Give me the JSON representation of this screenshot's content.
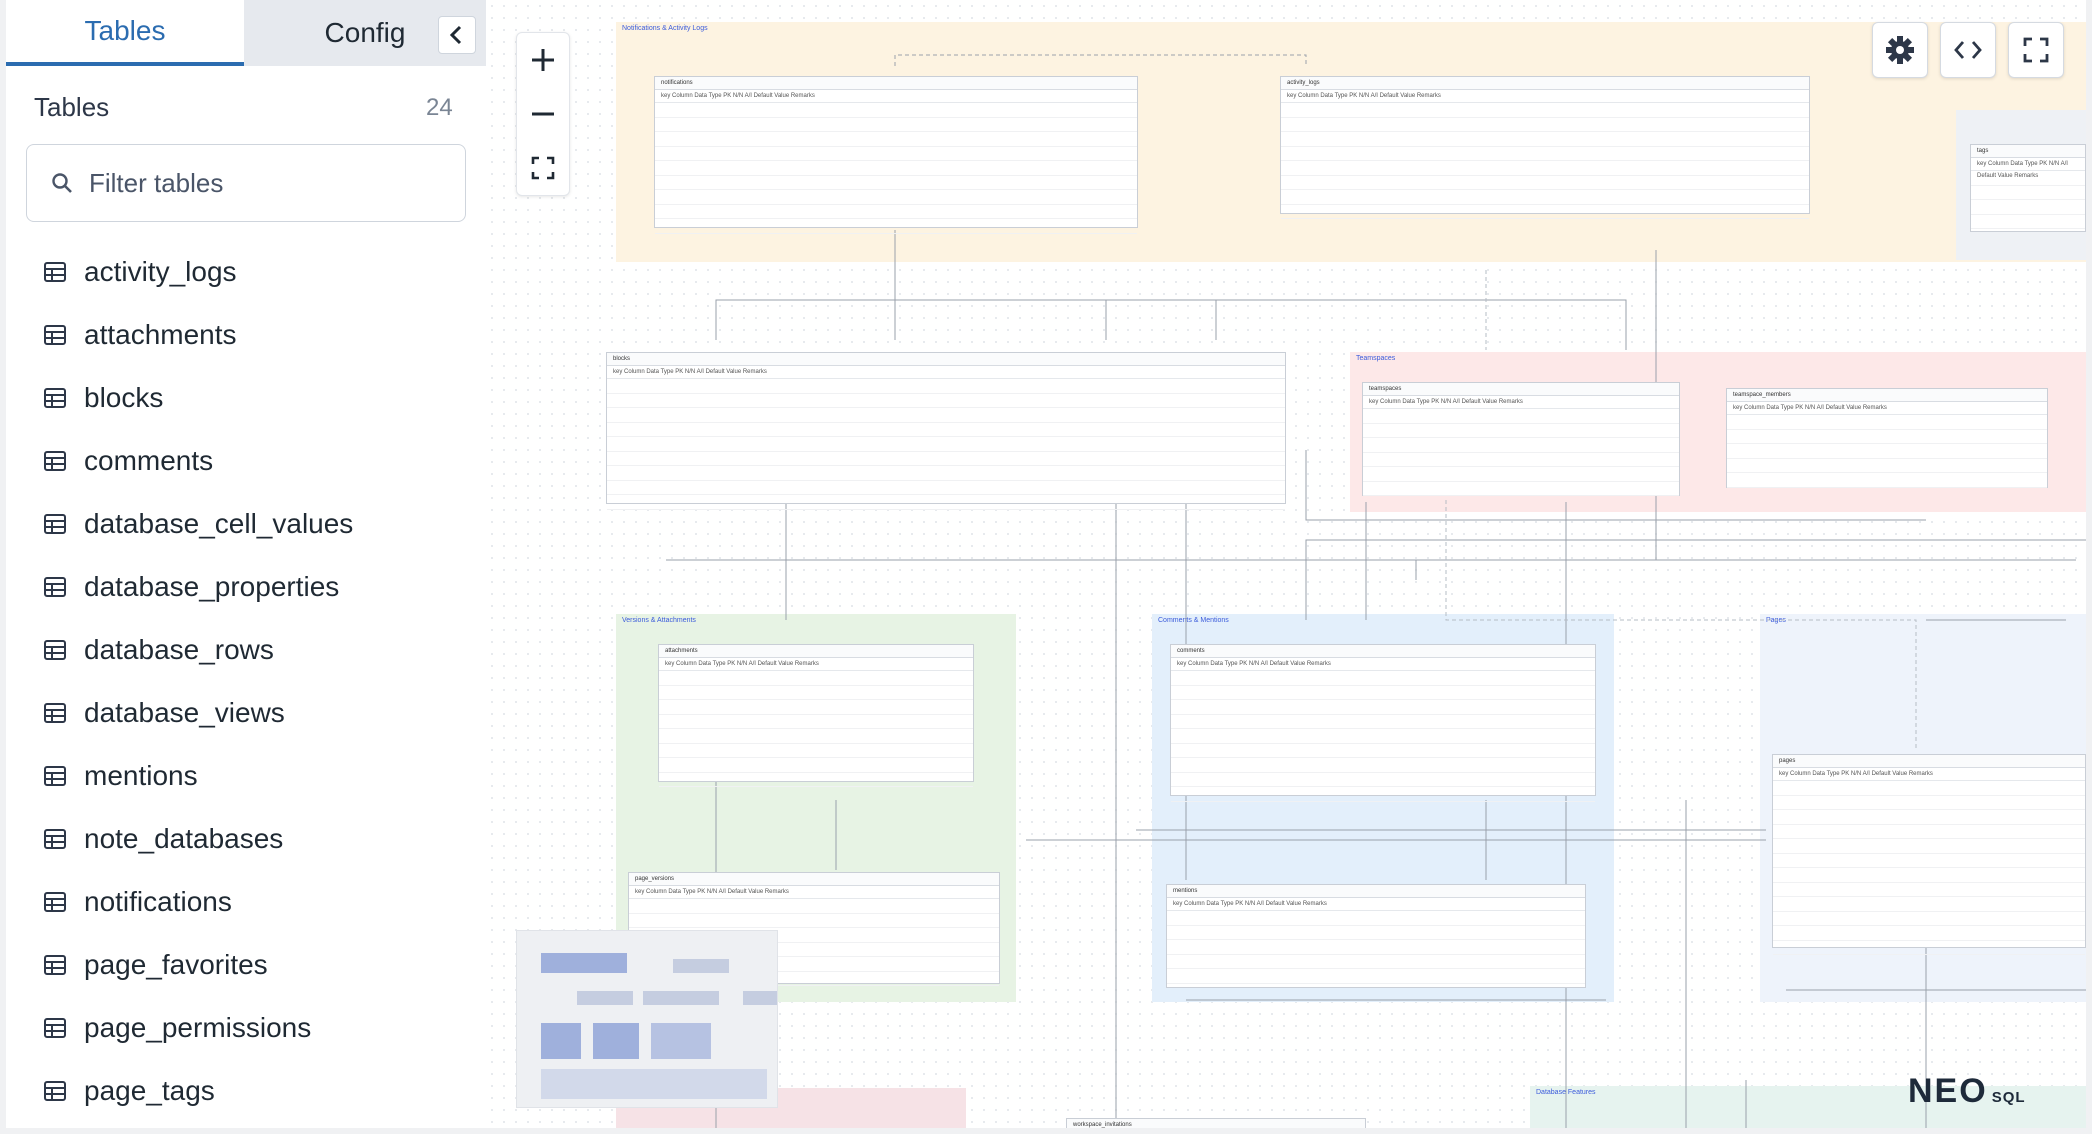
{
  "sidebar": {
    "tabs": [
      {
        "label": "Tables"
      },
      {
        "label": "Config"
      }
    ],
    "section_title": "Tables",
    "table_count": "24",
    "filter_placeholder": "Filter tables",
    "tables": [
      {
        "label": "activity_logs"
      },
      {
        "label": "attachments"
      },
      {
        "label": "blocks"
      },
      {
        "label": "comments"
      },
      {
        "label": "database_cell_values"
      },
      {
        "label": "database_properties"
      },
      {
        "label": "database_rows"
      },
      {
        "label": "database_views"
      },
      {
        "label": "mentions"
      },
      {
        "label": "note_databases"
      },
      {
        "label": "notifications"
      },
      {
        "label": "page_favorites"
      },
      {
        "label": "page_permissions"
      },
      {
        "label": "page_tags"
      }
    ]
  },
  "toolbar": {
    "icons": [
      "plus-icon",
      "minus-icon",
      "fit-screen-icon",
      "gear-icon",
      "code-icon",
      "fullscreen-icon"
    ]
  },
  "canvas": {
    "groups": [
      {
        "label": "Notifications & Activity Logs",
        "color": "#fdf3e1"
      },
      {
        "label": "Teamspaces",
        "color": "#fde8e8"
      },
      {
        "label": "Versions & Attachments",
        "color": "#e7f3e4"
      },
      {
        "label": "Comments & Mentions",
        "color": "#e3effb"
      },
      {
        "label": "Pages",
        "color": "#eef3fb"
      },
      {
        "label": "Database Features",
        "color": "#e6f3ef"
      }
    ],
    "tables": [
      {
        "name": "notifications"
      },
      {
        "name": "activity_logs"
      },
      {
        "name": "tags"
      },
      {
        "name": "blocks"
      },
      {
        "name": "teamspaces"
      },
      {
        "name": "teamspace_members"
      },
      {
        "name": "attachments"
      },
      {
        "name": "comments"
      },
      {
        "name": "pages"
      },
      {
        "name": "page_versions"
      },
      {
        "name": "mentions"
      },
      {
        "name": "workspace_invitations"
      }
    ],
    "column_headers": [
      "key",
      "Column",
      "Data Type",
      "PK",
      "N/N",
      "A/I",
      "Default Value",
      "Remarks"
    ]
  },
  "brand": {
    "logo": "NEO",
    "suffix": "SQL"
  }
}
